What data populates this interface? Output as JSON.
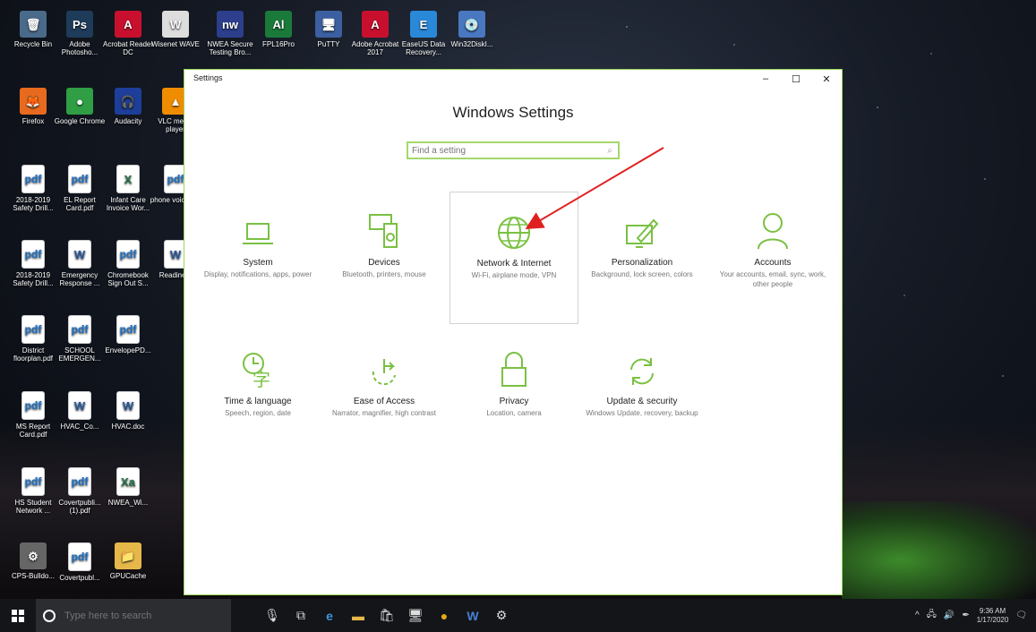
{
  "desktop": {
    "icons": [
      {
        "label": "Recycle Bin",
        "icon": "recycle-bin-icon",
        "glyph": "🗑",
        "bg": "#4a6a8a",
        "type": ""
      },
      {
        "label": "Adobe Photosho...",
        "icon": "photoshop-icon",
        "glyph": "Ps",
        "bg": "#1e3b5a",
        "type": ""
      },
      {
        "label": "Acrobat Reader DC",
        "icon": "acrobat-icon",
        "glyph": "A",
        "bg": "#c8102e",
        "type": ""
      },
      {
        "label": "Wisenet WAVE",
        "icon": "wisenet-icon",
        "glyph": "W",
        "bg": "#ddd",
        "type": ""
      },
      {
        "label": "NWEA Secure Testing Bro...",
        "icon": "nwea-icon",
        "glyph": "nw",
        "bg": "#2c3e8c",
        "type": ""
      },
      {
        "label": "FPL16Pro",
        "icon": "fpl-icon",
        "glyph": "Al",
        "bg": "#1a7a3a",
        "type": ""
      },
      {
        "label": "PuTTY",
        "icon": "putty-icon",
        "glyph": "🖥",
        "bg": "#3b5fa0",
        "type": ""
      },
      {
        "label": "Adobe Acrobat 2017",
        "icon": "acrobat-2017-icon",
        "glyph": "A",
        "bg": "#c8102e",
        "type": ""
      },
      {
        "label": "EaseUS Data Recovery...",
        "icon": "easeus-icon",
        "glyph": "E",
        "bg": "#2a88d8",
        "type": ""
      },
      {
        "label": "Win32DiskI...",
        "icon": "disk-imager-icon",
        "glyph": "💿",
        "bg": "#4a78c0",
        "type": ""
      },
      {
        "label": "Firefox",
        "icon": "firefox-icon",
        "glyph": "🦊",
        "bg": "#e86a1e",
        "type": ""
      },
      {
        "label": "Google Chrome",
        "icon": "chrome-icon",
        "glyph": "●",
        "bg": "#2f9e44",
        "type": ""
      },
      {
        "label": "Audacity",
        "icon": "audacity-icon",
        "glyph": "🎧",
        "bg": "#1d3f9a",
        "type": ""
      },
      {
        "label": "VLC media player",
        "icon": "vlc-icon",
        "glyph": "▲",
        "bg": "#f08c00",
        "type": ""
      },
      {
        "label": "2018-2019 Safety Drill...",
        "icon": "pdf-file-icon",
        "glyph": "pdf",
        "bg": "",
        "type": "pdf"
      },
      {
        "label": "EL Report Card.pdf",
        "icon": "pdf-file-icon",
        "glyph": "pdf",
        "bg": "",
        "type": "pdf"
      },
      {
        "label": "Infant Care Invoice Wor...",
        "icon": "excel-file-icon",
        "glyph": "X",
        "bg": "",
        "type": "excel"
      },
      {
        "label": "phone voicem...",
        "icon": "pdf-file-icon",
        "glyph": "pdf",
        "bg": "",
        "type": "pdf"
      },
      {
        "label": "2018-2019 Safety Drill...",
        "icon": "pdf-file-icon",
        "glyph": "pdf",
        "bg": "",
        "type": "pdf"
      },
      {
        "label": "Emergency Response ...",
        "icon": "word-file-icon",
        "glyph": "W",
        "bg": "",
        "type": "word"
      },
      {
        "label": "Chromebook Sign Out S...",
        "icon": "pdf-file-icon",
        "glyph": "pdf",
        "bg": "",
        "type": "pdf"
      },
      {
        "label": "Readine...",
        "icon": "word-file-icon",
        "glyph": "W",
        "bg": "",
        "type": "word"
      },
      {
        "label": "District floorplan.pdf",
        "icon": "pdf-file-icon",
        "glyph": "pdf",
        "bg": "",
        "type": "pdf"
      },
      {
        "label": "SCHOOL EMERGEN...",
        "icon": "pdf-file-icon",
        "glyph": "pdf",
        "bg": "",
        "type": "pdf"
      },
      {
        "label": "EnvelopePD...",
        "icon": "pdf-file-icon",
        "glyph": "pdf",
        "bg": "",
        "type": "pdf"
      },
      {
        "label": "MS Report Card.pdf",
        "icon": "pdf-file-icon",
        "glyph": "pdf",
        "bg": "",
        "type": "pdf"
      },
      {
        "label": "HVAC_Co...",
        "icon": "word-file-icon",
        "glyph": "W",
        "bg": "",
        "type": "word"
      },
      {
        "label": "HVAC.doc",
        "icon": "word-file-icon",
        "glyph": "W",
        "bg": "",
        "type": "word"
      },
      {
        "label": "HS Student Network ...",
        "icon": "pdf-file-icon",
        "glyph": "pdf",
        "bg": "",
        "type": "pdf"
      },
      {
        "label": "Covertpubli... (1).pdf",
        "icon": "pdf-file-icon",
        "glyph": "pdf",
        "bg": "",
        "type": "pdf"
      },
      {
        "label": "NWEA_Wi...",
        "icon": "excel-file-icon",
        "glyph": "Xa",
        "bg": "",
        "type": "excel"
      },
      {
        "label": "CPS-Bulldo...",
        "icon": "gear-shortcut-icon",
        "glyph": "⚙",
        "bg": "#666",
        "type": ""
      },
      {
        "label": "Covertpubl...",
        "icon": "pdf-file-icon",
        "glyph": "pdf",
        "bg": "",
        "type": "pdf"
      },
      {
        "label": "GPUCache",
        "icon": "folder-icon",
        "glyph": "📁",
        "bg": "#e6b84a",
        "type": ""
      }
    ]
  },
  "window": {
    "title": "Settings",
    "minimize": "–",
    "maximize": "☐",
    "close": "✕",
    "heading": "Windows Settings",
    "search_placeholder": "Find a setting",
    "accent": "#7ac142",
    "tiles": [
      {
        "name": "System",
        "desc": "Display, notifications, apps, power",
        "icon": "laptop-icon"
      },
      {
        "name": "Devices",
        "desc": "Bluetooth, printers, mouse",
        "icon": "devices-icon"
      },
      {
        "name": "Network & Internet",
        "desc": "Wi-Fi, airplane mode, VPN",
        "icon": "globe-icon"
      },
      {
        "name": "Personalization",
        "desc": "Background, lock screen, colors",
        "icon": "paint-icon"
      },
      {
        "name": "Accounts",
        "desc": "Your accounts, email, sync, work, other people",
        "icon": "person-icon"
      },
      {
        "name": "Time & language",
        "desc": "Speech, region, date",
        "icon": "time-language-icon"
      },
      {
        "name": "Ease of Access",
        "desc": "Narrator, magnifier, high contrast",
        "icon": "ease-of-access-icon"
      },
      {
        "name": "Privacy",
        "desc": "Location, camera",
        "icon": "lock-icon"
      },
      {
        "name": "Update & security",
        "desc": "Windows Update, recovery, backup",
        "icon": "refresh-icon"
      }
    ]
  },
  "taskbar": {
    "search_placeholder": "Type here to search",
    "time": "9:36 AM",
    "date": "1/17/2020"
  }
}
